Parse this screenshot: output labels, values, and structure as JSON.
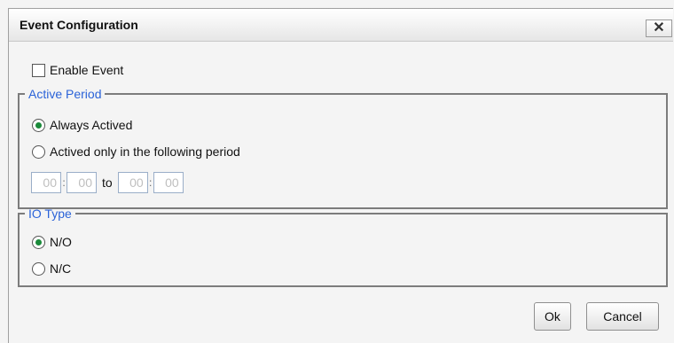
{
  "dialog": {
    "title": "Event Configuration",
    "close_label": "✕"
  },
  "enable_event": {
    "label": "Enable Event",
    "checked": false
  },
  "active_period": {
    "legend": "Active Period",
    "options": [
      {
        "label": "Always Actived",
        "selected": true
      },
      {
        "label": "Actived only in the following period",
        "selected": false
      }
    ],
    "time": {
      "start_hour": "00",
      "start_minute": "00",
      "to_label": "to",
      "end_hour": "00",
      "end_minute": "00",
      "separator": ":"
    }
  },
  "io_type": {
    "legend": "IO Type",
    "options": [
      {
        "label": "N/O",
        "selected": true
      },
      {
        "label": "N/C",
        "selected": false
      }
    ]
  },
  "buttons": {
    "ok_label": "Ok",
    "cancel_label": "Cancel"
  },
  "colors": {
    "legend": "#2b63d8",
    "radio_selected": "#1a8a3a"
  }
}
